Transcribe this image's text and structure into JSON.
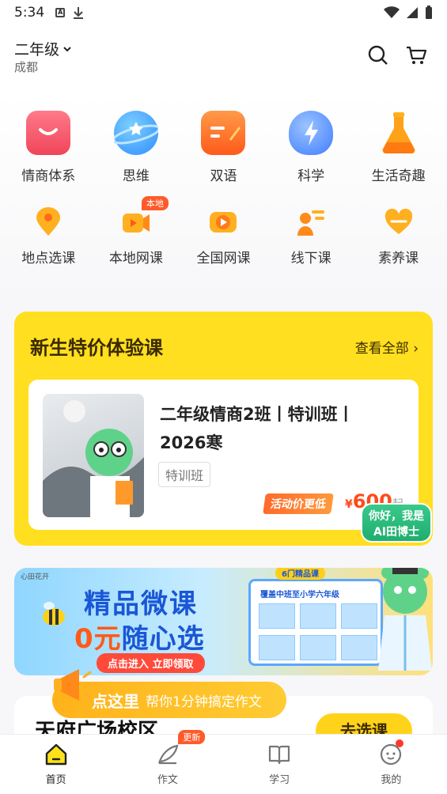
{
  "status_bar": {
    "time": "5:34",
    "notif_icon_text": "A"
  },
  "header": {
    "grade": "二年级",
    "city": "成都"
  },
  "categories_top": [
    {
      "label": "情商体系",
      "icon": "eq-icon",
      "color": "#f0455a"
    },
    {
      "label": "思维",
      "icon": "planet-icon",
      "color": "#3aa0ff"
    },
    {
      "label": "双语",
      "icon": "bilingual-icon",
      "color": "#ff6a2b"
    },
    {
      "label": "科学",
      "icon": "lightning-icon",
      "color": "#4a8bff"
    },
    {
      "label": "生活奇趣",
      "icon": "flask-icon",
      "color": "#ff9f1a"
    }
  ],
  "categories_bottom": [
    {
      "label": "地点选课",
      "icon": "location-icon",
      "color": "#ff9a1a"
    },
    {
      "label": "本地网课",
      "icon": "local-video-icon",
      "color": "#ff8a1a",
      "badge": "本地"
    },
    {
      "label": "全国网课",
      "icon": "video-icon",
      "color": "#ff8a1a"
    },
    {
      "label": "线下课",
      "icon": "offline-class-icon",
      "color": "#ff8a1a"
    },
    {
      "label": "素养课",
      "icon": "heart-icon",
      "color": "#ff9a1a"
    }
  ],
  "trial": {
    "title": "新生特价体验课",
    "view_all": "查看全部 ›",
    "course": {
      "name": "二年级情商2班丨特训班丨2026寒",
      "tag": "特训班",
      "promo": "活动价更低",
      "currency": "¥",
      "price": "600",
      "price_suffix": "起"
    }
  },
  "ai_bubble": {
    "line1": "你好，我是",
    "line2": "AI田博士"
  },
  "banner": {
    "brand": "心田花开",
    "title1": "精品微课",
    "title2_zero": "0元",
    "title2_rest": "随心选",
    "cta": "点击进入 立即领取",
    "panel_badge": "6门精品课",
    "panel_title": "覆盖中班至小学六年级"
  },
  "tip": {
    "strong": "点这里",
    "text": "帮你1分钟搞定作文"
  },
  "campus": {
    "name": "天府广场校区",
    "choose": "去选课"
  },
  "tabbar": [
    {
      "label": "首页",
      "icon": "home-icon",
      "active": true
    },
    {
      "label": "作文",
      "icon": "quill-icon",
      "badge": "更新"
    },
    {
      "label": "学习",
      "icon": "book-icon"
    },
    {
      "label": "我的",
      "icon": "profile-icon",
      "dot": true
    }
  ]
}
